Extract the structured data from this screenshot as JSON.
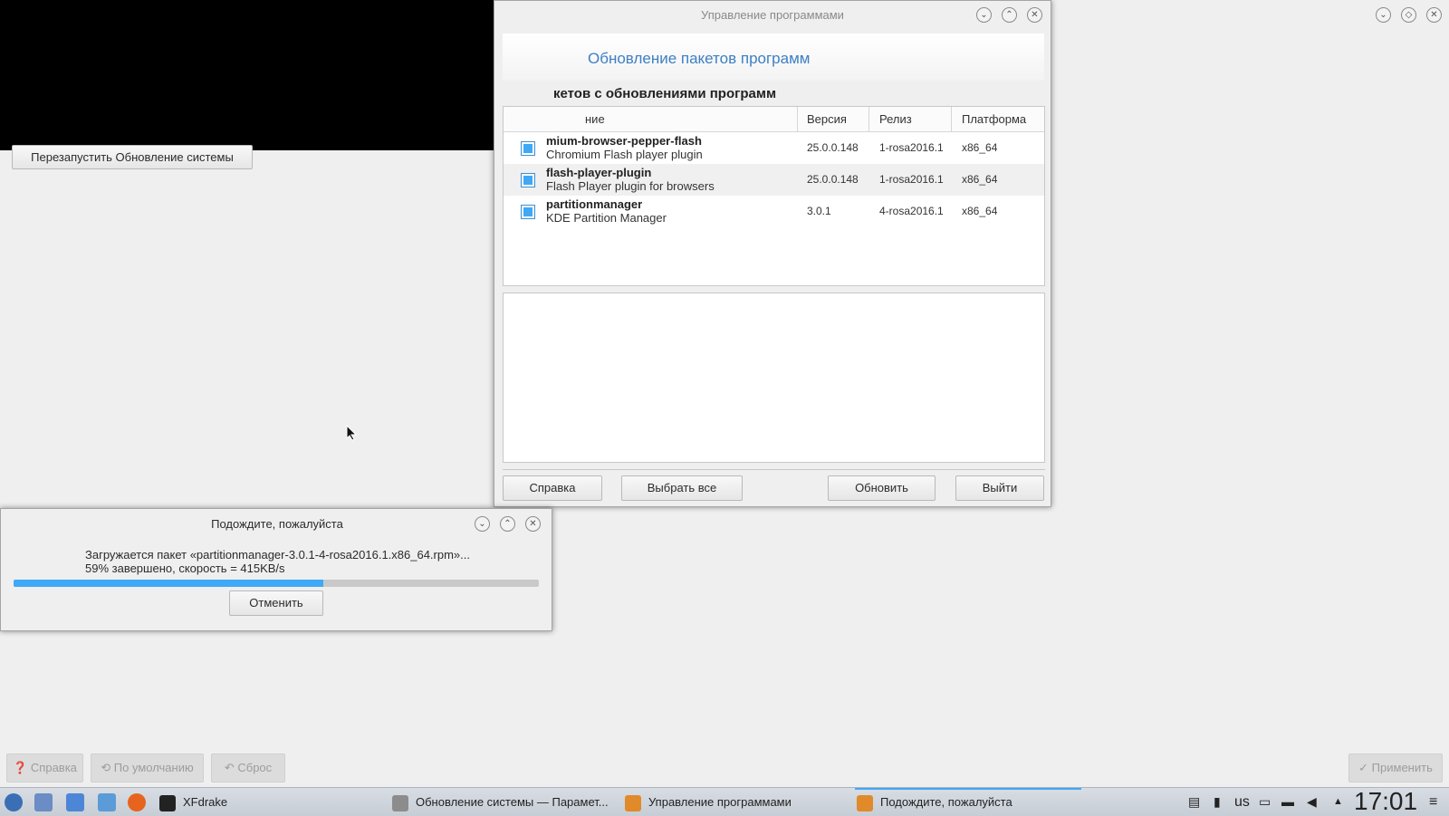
{
  "background_window": {
    "restart_button": "Перезапустить Обновление системы",
    "right_controls": [
      "chevron-down",
      "restore",
      "close"
    ]
  },
  "main_window": {
    "title": "Управление программами",
    "header": "Обновление пакетов программ",
    "subtitle": "кетов с обновлениями программ",
    "columns": [
      "ние",
      "Версия",
      "Релиз",
      "Платформа"
    ],
    "packages": [
      {
        "name": "mium-browser-pepper-flash",
        "desc": "Chromium Flash player plugin",
        "version": "25.0.0.148",
        "release": "1-rosa2016.1",
        "platform": "x86_64",
        "checked": true
      },
      {
        "name": "flash-player-plugin",
        "desc": "Flash Player plugin for browsers",
        "version": "25.0.0.148",
        "release": "1-rosa2016.1",
        "platform": "x86_64",
        "checked": true
      },
      {
        "name": "partitionmanager",
        "desc": "KDE Partition Manager",
        "version": "3.0.1",
        "release": "4-rosa2016.1",
        "platform": "x86_64",
        "checked": true
      }
    ],
    "buttons": {
      "help": "Справка",
      "select_all": "Выбрать все",
      "update": "Обновить",
      "exit": "Выйти"
    }
  },
  "wait_dialog": {
    "title": "Подождите, пожалуйста",
    "line1": "Загружается пакет «partitionmanager-3.0.1-4-rosa2016.1.x86_64.rpm»...",
    "line2": "59% завершено, скорость = 415KB/s",
    "progress": 0.59,
    "cancel": "Отменить"
  },
  "settings_bottom": {
    "help": "Справка",
    "defaults": "По умолчанию",
    "reset": "Сброс",
    "apply": "Применить"
  },
  "taskbar": {
    "tasks": [
      {
        "label": "XFdrake"
      },
      {
        "label": "Обновление системы — Парамет..."
      },
      {
        "label": "Управление программами"
      },
      {
        "label": "Подождите, пожалуйста"
      }
    ],
    "keyboard_layout": "us",
    "clock": "17:01"
  },
  "colors": {
    "accent": "#3fa9f5",
    "header_text": "#3d7fc4"
  }
}
